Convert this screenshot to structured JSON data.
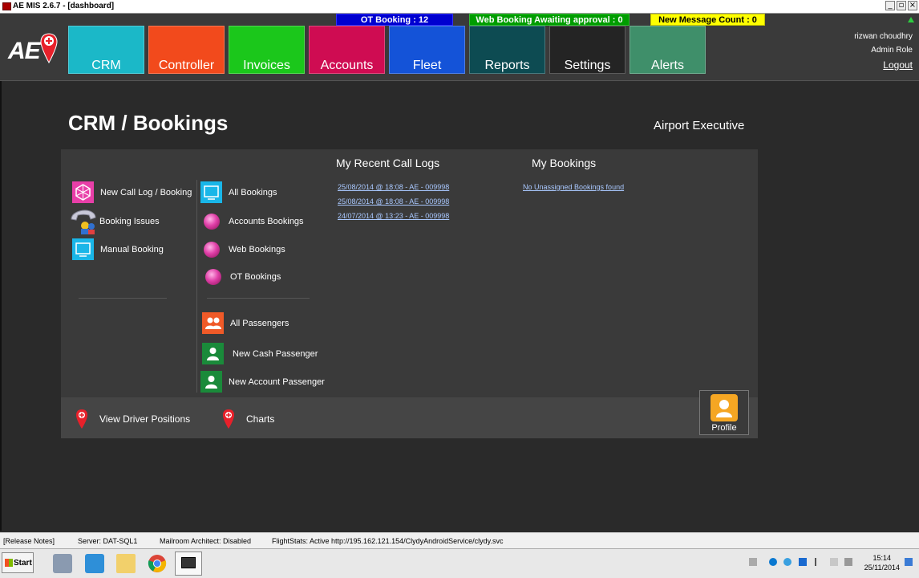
{
  "window": {
    "title": "AE MIS 2.6.7 - [dashboard]",
    "min": "_",
    "restore": "▫",
    "close": "×"
  },
  "header": {
    "logo": "AE",
    "badges": {
      "ot": "OT Booking : 12",
      "web": "Web Booking Awaiting approval : 0",
      "msg": "New Message Count : 0"
    },
    "tiles": [
      "CRM",
      "Controller",
      "Invoices",
      "Accounts",
      "Fleet",
      "Reports",
      "Settings",
      "Alerts"
    ],
    "user": {
      "name": "rizwan choudhry",
      "role": "Admin Role",
      "logout": "Logout"
    }
  },
  "page": {
    "title": "CRM / Bookings",
    "company": "Airport Executive"
  },
  "menu": {
    "col1": [
      "New Call Log / Booking",
      "Booking Issues",
      "Manual Booking"
    ],
    "col2": [
      "All Bookings",
      "Accounts Bookings",
      "Web Bookings",
      "OT Bookings"
    ],
    "col3": [
      "All Passengers",
      "New Cash Passenger",
      "New Account Passenger"
    ]
  },
  "call_logs": {
    "heading": "My Recent Call Logs",
    "items": [
      "25/08/2014 @ 18:08 - AE - 009998",
      "25/08/2014 @ 18:08 - AE - 009998",
      "24/07/2014 @ 13:23 - AE - 009998"
    ]
  },
  "my_bookings": {
    "heading": "My Bookings",
    "empty": "No Unassigned Bookings found"
  },
  "bottom": {
    "driver_positions": "View Driver Positions",
    "charts": "Charts",
    "profile": "Profile"
  },
  "statusbar": {
    "release": "[Release Notes]",
    "server": "Server: DAT-SQL1",
    "mailroom": "Mailroom Architect: Disabled",
    "flightstats": "FlightStats: Active  http://195.162.121.154/ClydyAndroidService/clydy.svc"
  },
  "taskbar": {
    "start": "Start",
    "time": "15:14",
    "date": "25/11/2014"
  },
  "colors": {
    "crm": "#1bb8c8",
    "controller": "#f24a1c",
    "invoices": "#1bc71b",
    "accounts": "#cf0c52",
    "fleet": "#1453d8",
    "reports": "#0d4b52",
    "settings": "#242424",
    "alerts": "#3f8f6a"
  }
}
